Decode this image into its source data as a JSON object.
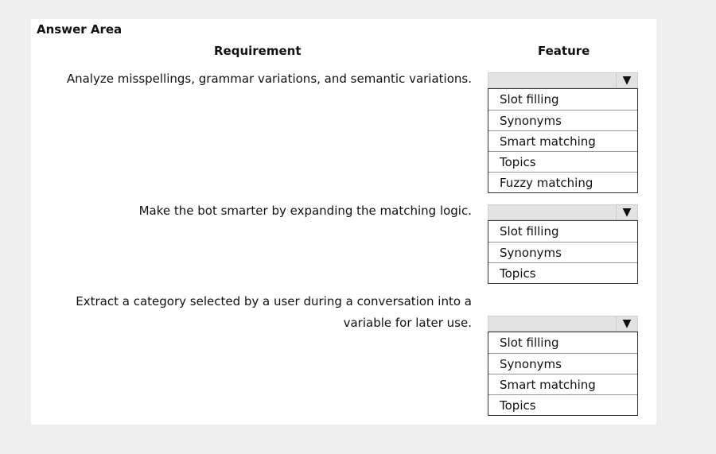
{
  "title": "Answer Area",
  "headers": {
    "requirement": "Requirement",
    "feature": "Feature"
  },
  "rows": [
    {
      "requirement_lines": [
        "Analyze misspellings, grammar variations, and semantic variations."
      ],
      "options": [
        "Slot filling",
        "Synonyms",
        "Smart matching",
        "Topics",
        "Fuzzy matching"
      ]
    },
    {
      "requirement_lines": [
        "Make the bot smarter by expanding the matching logic."
      ],
      "options": [
        "Slot filling",
        "Synonyms",
        "Topics"
      ]
    },
    {
      "requirement_lines": [
        "Extract a category selected by a user during a conversation into a",
        "variable for later use."
      ],
      "options": [
        "Slot filling",
        "Synonyms",
        "Smart matching",
        "Topics"
      ]
    }
  ],
  "icons": {
    "dropdown_arrow": "▼"
  }
}
